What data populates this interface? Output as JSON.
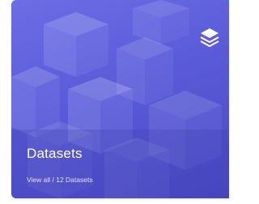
{
  "card": {
    "title": "Datasets",
    "subtitle": "View all / 12 Datasets",
    "icon": "layers-icon",
    "colors": {
      "gradient_start": "#6d6ee6",
      "gradient_end": "#4a49c4",
      "text": "#ffffff"
    }
  }
}
